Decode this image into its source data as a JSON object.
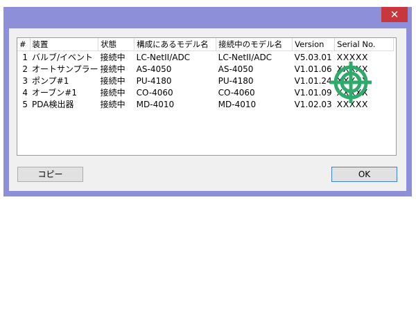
{
  "window": {
    "close_symbol": "✕"
  },
  "table": {
    "headers": [
      "#",
      "装置",
      "状態",
      "構成にあるモデル名",
      "接続中のモデル名",
      "Version",
      "Serial No."
    ],
    "rows": [
      [
        "1",
        "バルブ/イベント",
        "接続中",
        "LC-NetII/ADC",
        "LC-NetII/ADC",
        "V5.03.01",
        "XXXXX"
      ],
      [
        "2",
        "オートサンプラー",
        "接続中",
        "AS-4050",
        "AS-4050",
        "V1.01.06",
        "XXXXX"
      ],
      [
        "3",
        "ポンプ#1",
        "接続中",
        "PU-4180",
        "PU-4180",
        "V1.01.24",
        "XXXXX"
      ],
      [
        "4",
        "オーブン#1",
        "接続中",
        "CO-4060",
        "CO-4060",
        "V1.01.09",
        "XXXXX"
      ],
      [
        "5",
        "PDA検出器",
        "接続中",
        "MD-4010",
        "MD-4010",
        "V1.02.03",
        "XXXXX"
      ]
    ]
  },
  "buttons": {
    "copy_label": "コピー",
    "ok_label": "OK"
  },
  "overlay": {
    "icon": "crosshair-target-icon",
    "color": "#2eaa6a"
  },
  "colors": {
    "window_frame": "#8d8fd8",
    "close_button": "#c7373c",
    "client": "#f0f0f0"
  }
}
